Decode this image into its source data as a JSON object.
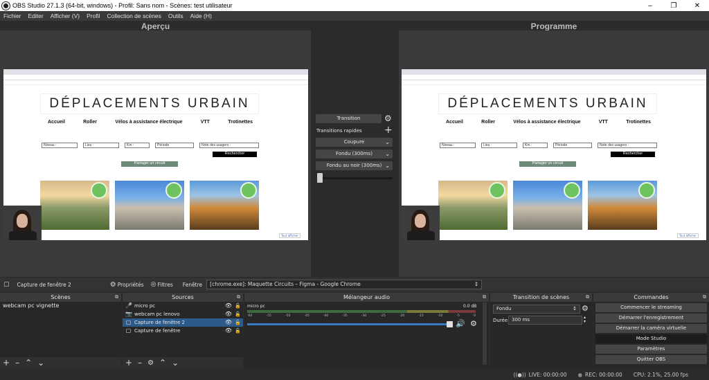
{
  "window": {
    "title": "OBS Studio 27.1.3 (64-bit, windows) - Profil: Sans nom - Scènes: test utilisateur"
  },
  "menu": [
    "Fichier",
    "Editer",
    "Afficher (V)",
    "Profil",
    "Collection de scènes",
    "Outils",
    "Aide (H)"
  ],
  "preview": {
    "title": "Aperçu"
  },
  "program": {
    "title": "Programme"
  },
  "site": {
    "title": "DÉPLACEMENTS URBAIN",
    "nav": [
      "Accueil",
      "Roller",
      "Vélos à assistance électrique",
      "VTT",
      "Trotinettes"
    ],
    "filters": [
      "Niveau :",
      "Lieu :",
      "Km :",
      "Période",
      "Note des usagers :"
    ],
    "search_label": "Rechercher",
    "share_label": "Partager un circuit",
    "corner_link": "Tout afficher"
  },
  "transition_panel": {
    "transition_label": "Transition",
    "quick_label": "Transitions rapides",
    "items": [
      "Coupure",
      "Fondu (300ms)",
      "Fondu au noir (300ms)"
    ]
  },
  "sourcebar": {
    "source_name": "Capture de fenêtre 2",
    "properties_label": "Propriétés",
    "filters_label": "Filtres",
    "window_label": "Fenêtre",
    "window_value": "[chrome.exe]: Maquette Circuits – Figma - Google Chrome"
  },
  "scenes": {
    "title": "Scènes",
    "items": [
      "webcam pc vignette"
    ]
  },
  "sources": {
    "title": "Sources",
    "items": [
      {
        "label": "micro pc",
        "icon": "microphone-icon"
      },
      {
        "label": "webcam pc lenovo",
        "icon": "camera-icon"
      },
      {
        "label": "Capture de fenêtre 2",
        "icon": "window-icon"
      },
      {
        "label": "Capture de fenêtre",
        "icon": "window-icon"
      }
    ]
  },
  "mixer": {
    "title": "Mélangeur audio",
    "channel_name": "micro pc",
    "db_value": "0.0 dB",
    "scale": [
      "-60",
      "-55",
      "-50",
      "-45",
      "-40",
      "-35",
      "-30",
      "-25",
      "-20",
      "-15",
      "-10",
      "-5",
      "0"
    ]
  },
  "scene_transition": {
    "title": "Transition de scènes",
    "selected": "Fondu",
    "duration_label": "Durée",
    "duration_value": "300 ms"
  },
  "commands": {
    "title": "Commandes",
    "buttons": [
      "Commencer le streaming",
      "Démarrer l'enregistrement",
      "Démarrer la caméra virtuelle",
      "Mode Studio",
      "Paramètres",
      "Quitter OBS"
    ]
  },
  "status": {
    "live": "LIVE: 00:00:00",
    "rec": "REC: 00:00:00",
    "perf": "CPU: 2.1%, 25.00 fps"
  },
  "colors": {
    "accent_selected": "#2e5a8a",
    "panel_bg": "#272727",
    "header_bg": "#3a3a3a"
  }
}
